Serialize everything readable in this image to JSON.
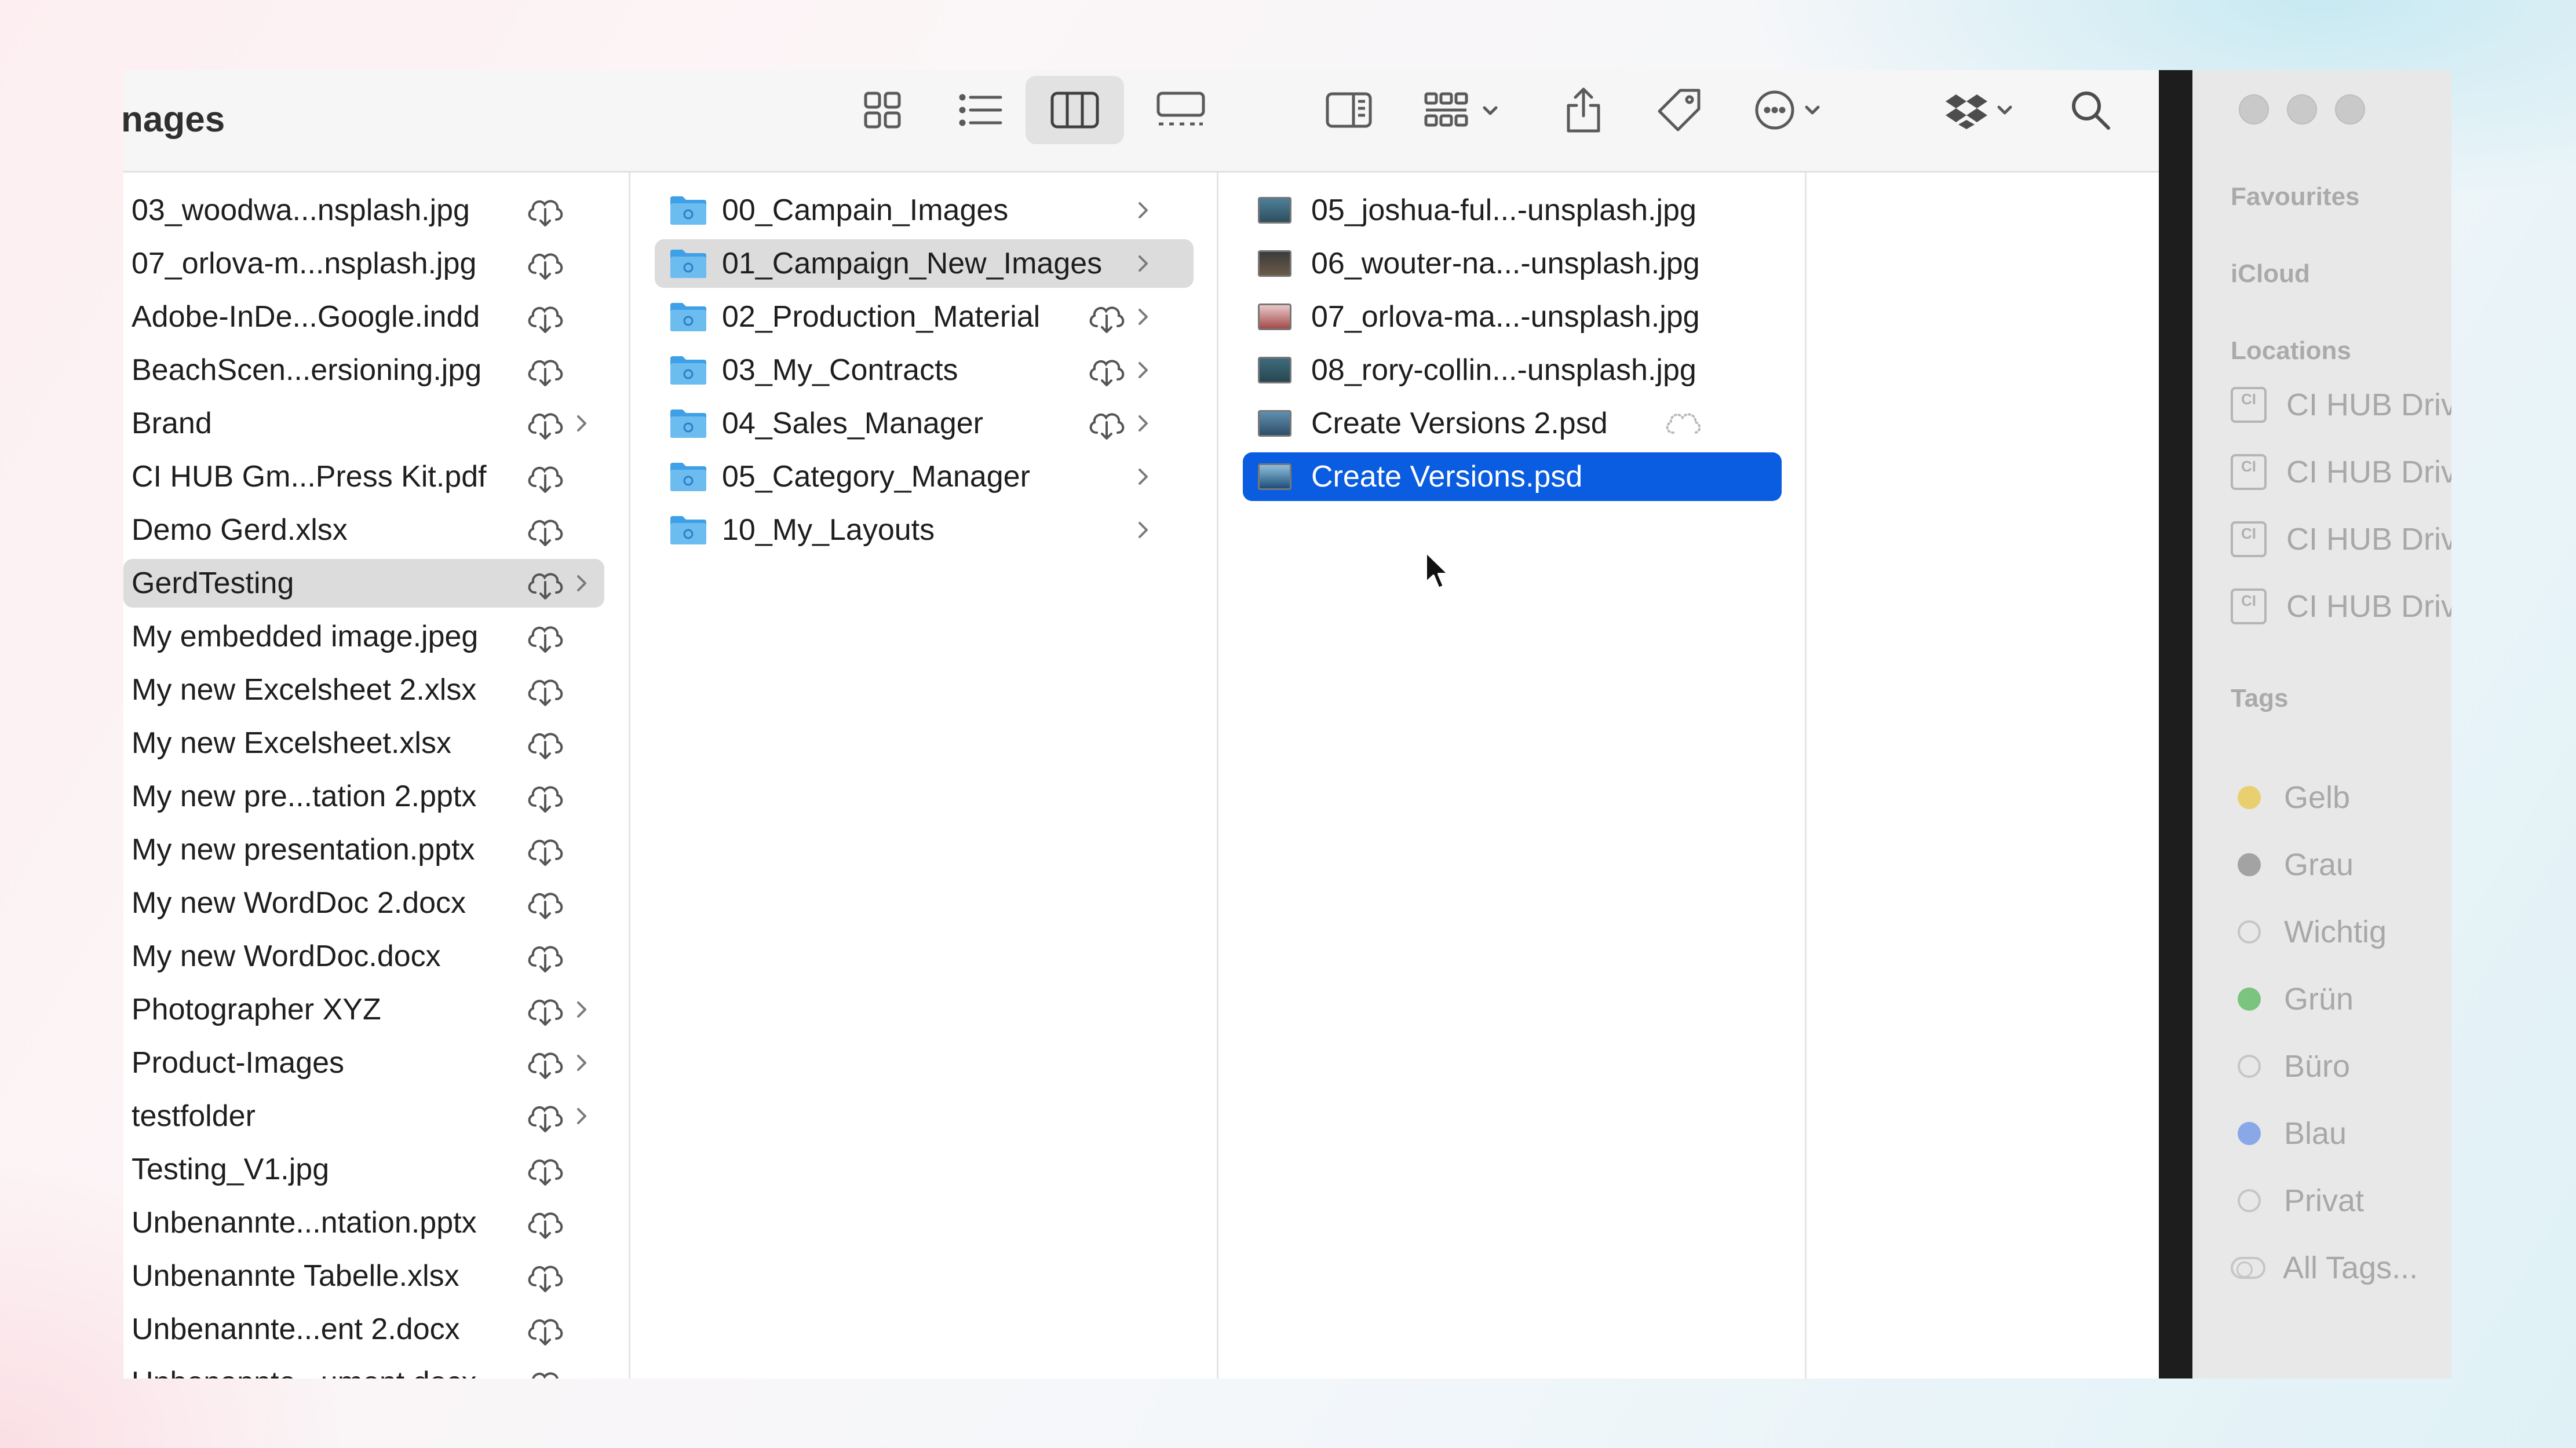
{
  "window": {
    "title": "nages"
  },
  "toolbar": {
    "view_icons": "icon-view-icon",
    "view_list": "list-view-icon",
    "view_columns": "column-view-icon",
    "view_gallery": "gallery-view-icon",
    "preview": "preview-pane-icon",
    "group": "group-by-icon",
    "share": "share-icon",
    "tag": "tag-icon",
    "more": "more-actions-icon",
    "dropbox": "dropbox-icon",
    "search": "search-icon"
  },
  "column1": {
    "items": [
      {
        "name": "03_woodwa...nsplash.jpg"
      },
      {
        "name": "07_orlova-m...nsplash.jpg"
      },
      {
        "name": "Adobe-InDe...Google.indd"
      },
      {
        "name": "BeachScen...ersioning.jpg"
      },
      {
        "name": "Brand"
      },
      {
        "name": "CI HUB Gm...Press Kit.pdf"
      },
      {
        "name": "Demo Gerd.xlsx"
      },
      {
        "name": "GerdTesting"
      },
      {
        "name": "My embedded image.jpeg"
      },
      {
        "name": "My new Excelsheet 2.xlsx"
      },
      {
        "name": "My new Excelsheet.xlsx"
      },
      {
        "name": "My new pre...tation 2.pptx"
      },
      {
        "name": "My new presentation.pptx"
      },
      {
        "name": "My new WordDoc 2.docx"
      },
      {
        "name": "My new WordDoc.docx"
      },
      {
        "name": "Photographer XYZ"
      },
      {
        "name": "Product-Images"
      },
      {
        "name": "testfolder"
      },
      {
        "name": "Testing_V1.jpg"
      },
      {
        "name": "Unbenannte...ntation.pptx"
      },
      {
        "name": "Unbenannte Tabelle.xlsx"
      },
      {
        "name": "Unbenannte...ent 2.docx"
      },
      {
        "name": "Unbenannte...ument.docx"
      }
    ]
  },
  "column2": {
    "items": [
      {
        "name": "00_Campain_Images"
      },
      {
        "name": "01_Campaign_New_Images"
      },
      {
        "name": "02_Production_Material"
      },
      {
        "name": "03_My_Contracts"
      },
      {
        "name": "04_Sales_Manager"
      },
      {
        "name": "05_Category_Manager"
      },
      {
        "name": "10_My_Layouts"
      }
    ]
  },
  "column3": {
    "items": [
      {
        "name": "05_joshua-ful...-unsplash.jpg"
      },
      {
        "name": "06_wouter-na...-unsplash.jpg"
      },
      {
        "name": "07_orlova-ma...-unsplash.jpg"
      },
      {
        "name": "08_rory-collin...-unsplash.jpg"
      },
      {
        "name": "Create Versions 2.psd"
      },
      {
        "name": "Create Versions.psd"
      }
    ]
  },
  "sidebar": {
    "favourites": "Favourites",
    "icloud": "iCloud",
    "locations": "Locations",
    "location_items": [
      "CI HUB Driv",
      "CI HUB Driv",
      "CI HUB Driv",
      "CI HUB Driv"
    ],
    "hd_icon_text": "CI",
    "tags_heading": "Tags",
    "tags": [
      {
        "name": "Gelb",
        "color": "#e9cf6f"
      },
      {
        "name": "Grau",
        "color": "#a3a3a3"
      },
      {
        "name": "Wichtig",
        "color": ""
      },
      {
        "name": "Grün",
        "color": "#7ac47f"
      },
      {
        "name": "Büro",
        "color": ""
      },
      {
        "name": "Blau",
        "color": "#8aa8e8"
      },
      {
        "name": "Privat",
        "color": ""
      },
      {
        "name": "All Tags...",
        "color": ""
      }
    ]
  },
  "colors": {
    "selection_blue": "#0a5ce0",
    "selection_gray": "#dcdcdc",
    "folder_blue": "#3ea0e6"
  }
}
